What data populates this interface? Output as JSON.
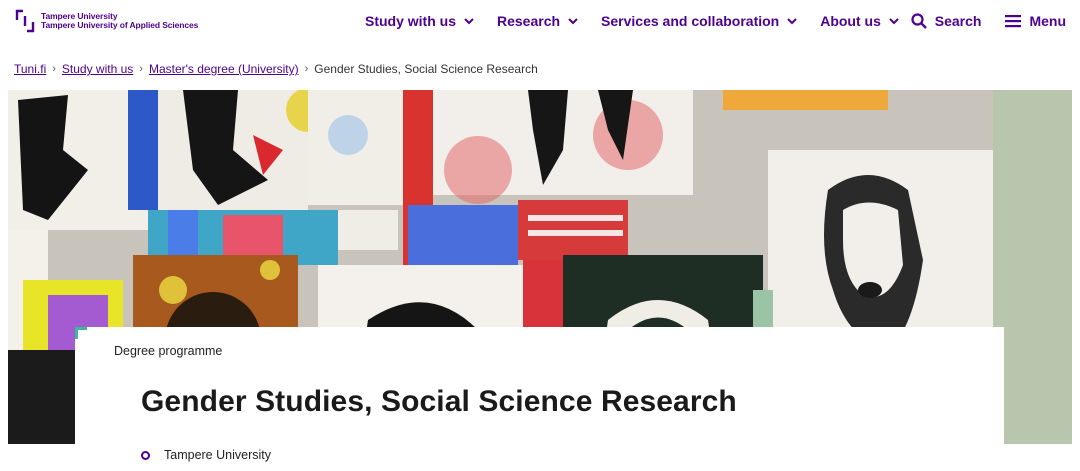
{
  "header": {
    "logo": {
      "line1": "Tampere University",
      "line2": "Tampere University of Applied Sciences",
      "color": "#4e008e"
    },
    "nav": [
      {
        "label": "Study with us"
      },
      {
        "label": "Research"
      },
      {
        "label": "Services and collaboration"
      },
      {
        "label": "About us"
      }
    ],
    "search_label": "Search",
    "menu_label": "Menu"
  },
  "breadcrumb": {
    "items": [
      {
        "label": "Tuni.fi"
      },
      {
        "label": "Study with us"
      },
      {
        "label": "Master's degree (University)"
      }
    ],
    "current": "Gender Studies, Social Science Research"
  },
  "hero": {
    "icon": "textile-collage-image"
  },
  "card": {
    "kicker": "Degree programme",
    "title": "Gender Studies, Social Science Research",
    "organization": "Tampere University",
    "accent_color": "#3cb89a"
  }
}
